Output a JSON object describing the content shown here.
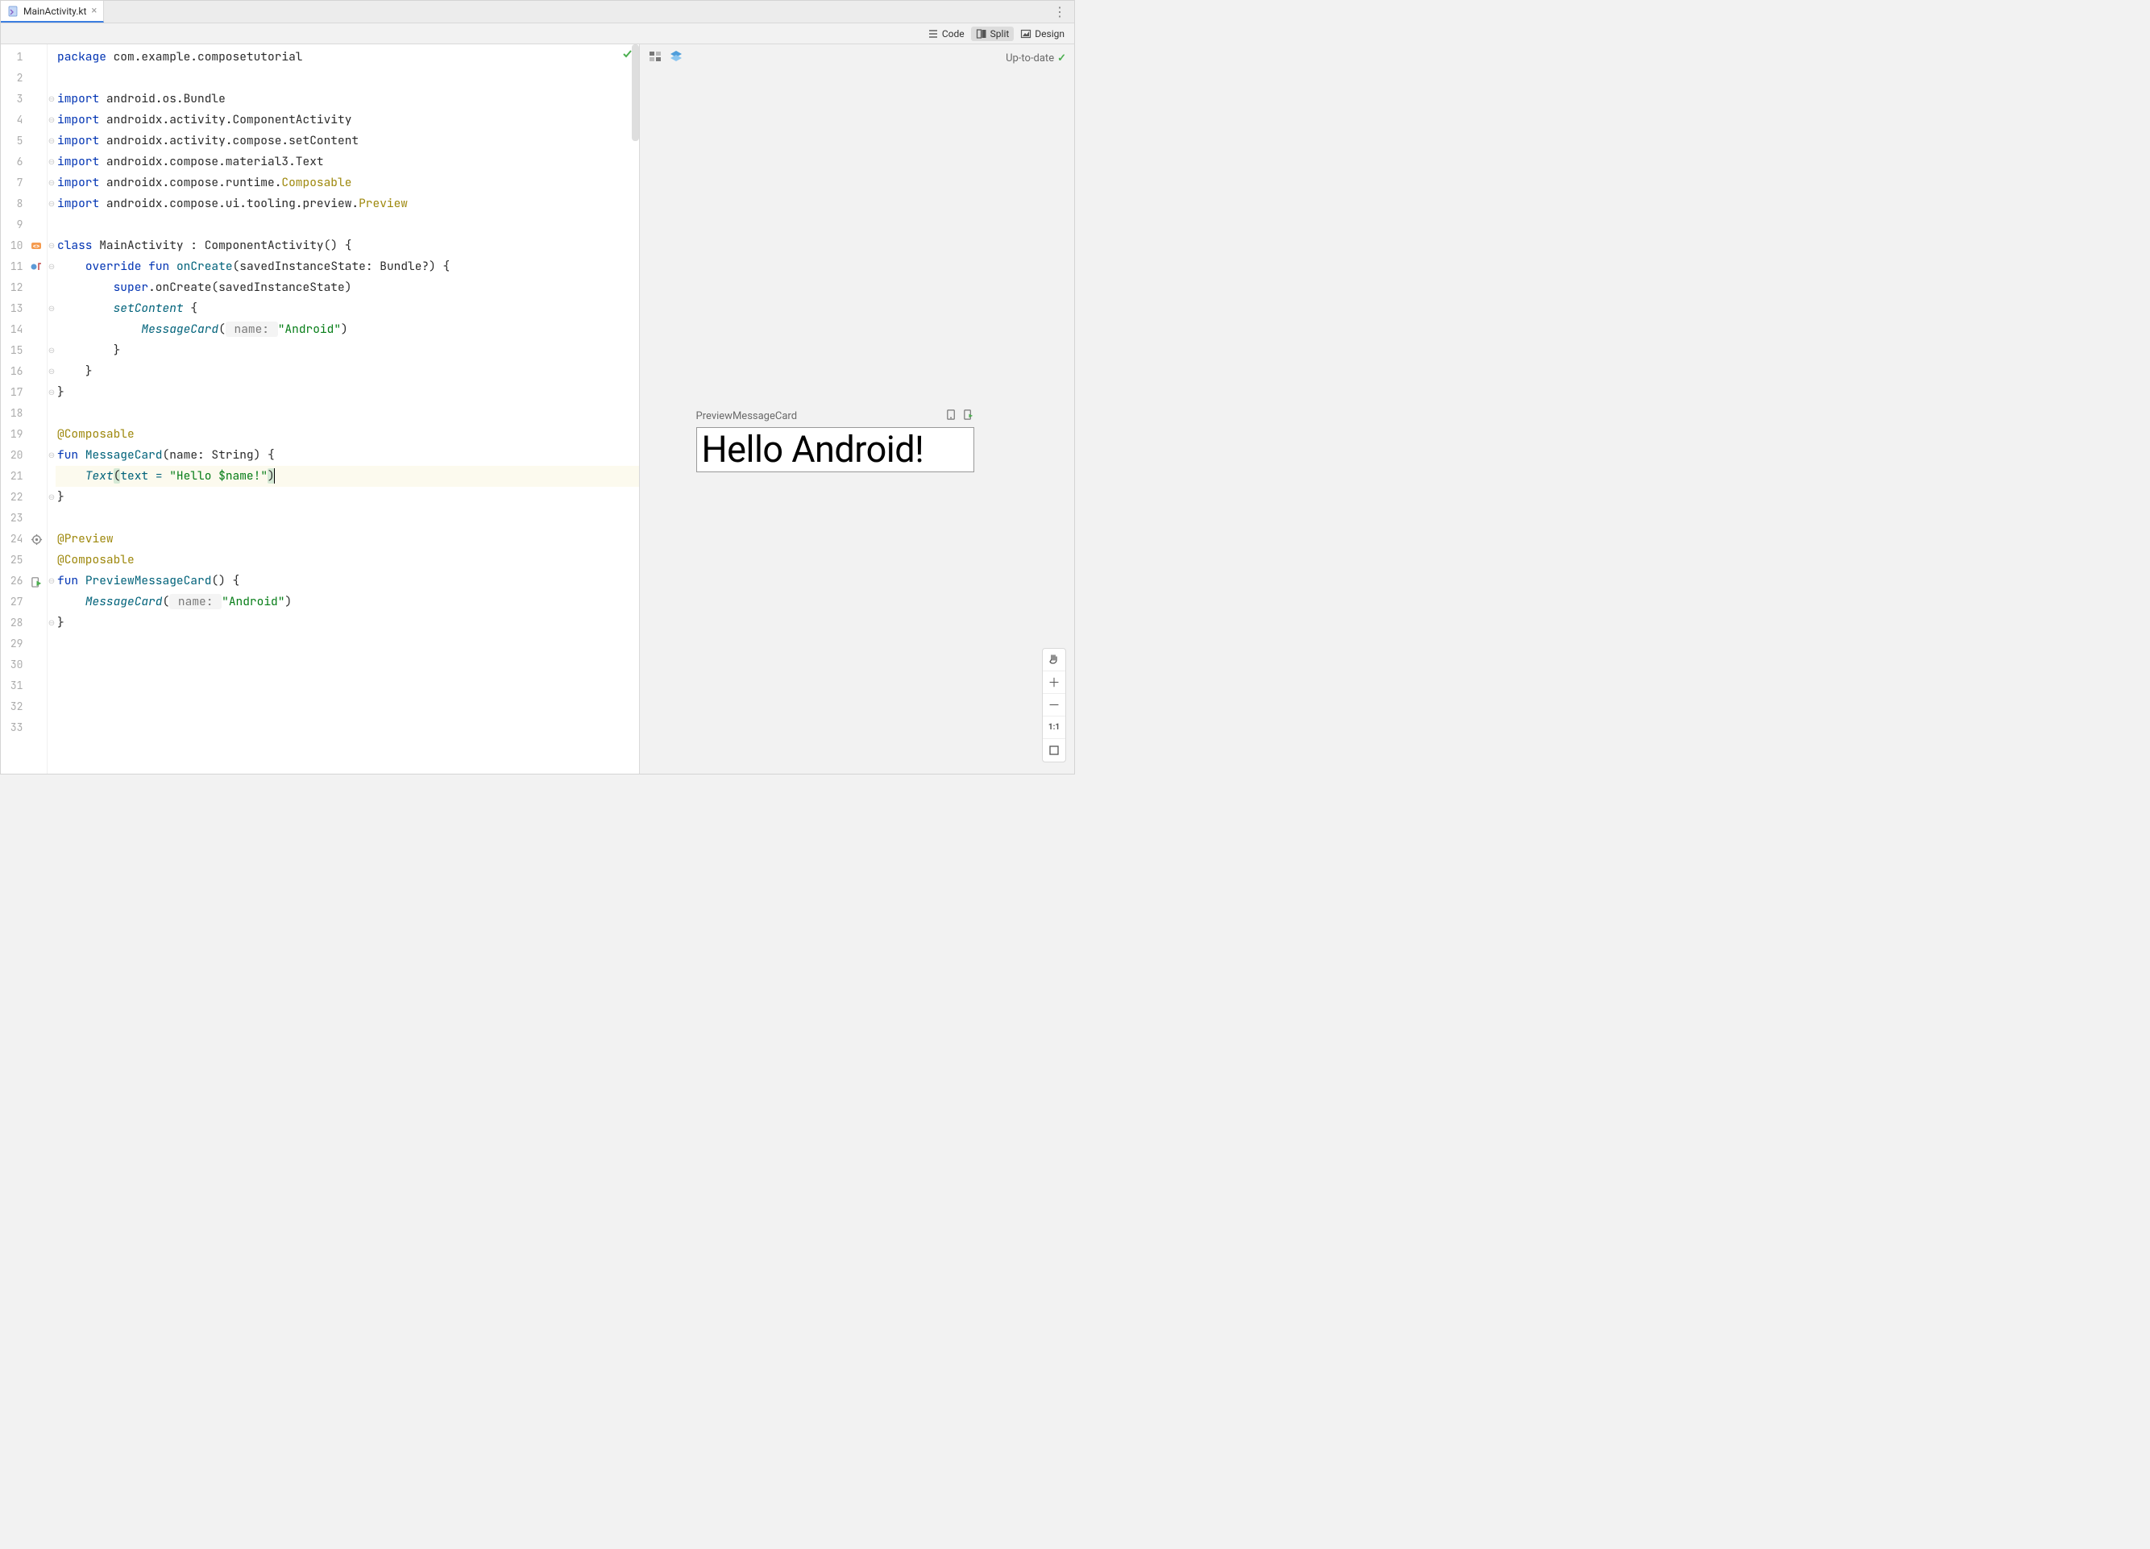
{
  "tab": {
    "filename": "MainActivity.kt"
  },
  "mode": {
    "code": "Code",
    "split": "Split",
    "design": "Design"
  },
  "preview": {
    "status": "Up-to-date",
    "composable_name": "PreviewMessageCard",
    "render_text": "Hello Android!"
  },
  "zoom": {
    "ratio_label": "1:1"
  },
  "code": {
    "l1": {
      "kw": "package",
      "rest": " com.example.composetutorial"
    },
    "l3": {
      "kw": "import",
      "rest": " android.os.Bundle"
    },
    "l4": {
      "kw": "import",
      "rest": " androidx.activity.ComponentActivity"
    },
    "l5": {
      "kw": "import",
      "rest": " androidx.activity.compose.setContent"
    },
    "l6": {
      "kw": "import",
      "rest": " androidx.compose.material3.Text"
    },
    "l7": {
      "kw": "import",
      "pkg": " androidx.compose.runtime.",
      "cls": "Composable"
    },
    "l8": {
      "kw": "import",
      "pkg": " androidx.compose.ui.tooling.preview.",
      "cls": "Preview"
    },
    "l10": {
      "kw1": "class",
      "name": " MainActivity : ComponentActivity() {"
    },
    "l11": {
      "indent": "    ",
      "kw1": "override",
      "sp": " ",
      "kw2": "fun",
      "sp2": " ",
      "fn": "onCreate",
      "sig": "(savedInstanceState: Bundle?) {"
    },
    "l12": {
      "indent": "        ",
      "kw": "super",
      "rest": ".onCreate(savedInstanceState)"
    },
    "l13": {
      "indent": "        ",
      "fn": "setContent",
      "rest": " {"
    },
    "l14": {
      "indent": "            ",
      "fn": "MessageCard",
      "open": "(",
      "hint": " name: ",
      "str": "\"Android\"",
      "close": ")"
    },
    "l15": {
      "text": "        }"
    },
    "l16": {
      "text": "    }"
    },
    "l17": {
      "text": "}"
    },
    "l19": {
      "ann": "@Composable"
    },
    "l20": {
      "kw": "fun",
      "sp": " ",
      "fn": "MessageCard",
      "sig": "(name: String) {"
    },
    "l21": {
      "indent": "    ",
      "fn": "Text",
      "open": "(",
      "arg1": "text = ",
      "str": "\"Hello $name!\"",
      "close": ")"
    },
    "l22": {
      "text": "}"
    },
    "l24": {
      "ann": "@Preview"
    },
    "l25": {
      "ann": "@Composable"
    },
    "l26": {
      "kw": "fun",
      "sp": " ",
      "fn": "PreviewMessageCard",
      "sig": "() {"
    },
    "l27": {
      "indent": "    ",
      "fn": "MessageCard",
      "open": "(",
      "hint": " name: ",
      "str": "\"Android\"",
      "close": ")"
    },
    "l28": {
      "text": "}"
    }
  },
  "line_numbers": [
    "1",
    "2",
    "3",
    "4",
    "5",
    "6",
    "7",
    "8",
    "9",
    "10",
    "11",
    "12",
    "13",
    "14",
    "15",
    "16",
    "17",
    "18",
    "19",
    "20",
    "21",
    "22",
    "23",
    "24",
    "25",
    "26",
    "27",
    "28",
    "29",
    "30",
    "31",
    "32",
    "33"
  ]
}
